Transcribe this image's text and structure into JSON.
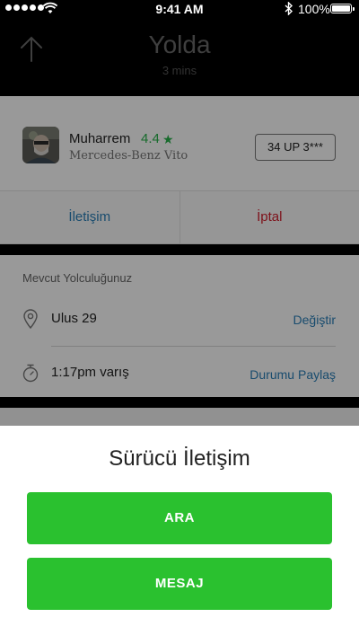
{
  "status_bar": {
    "time": "9:41 AM",
    "battery": "100%",
    "icons": [
      "signal-dots-icon",
      "wifi-icon",
      "bluetooth-icon",
      "battery-icon"
    ]
  },
  "header": {
    "title": "Yolda",
    "subtitle": "3 mins",
    "back_icon": "arrow-up-icon"
  },
  "driver": {
    "name": "Muharrem",
    "rating": "4.4",
    "rating_icon": "star-icon",
    "car": "Mercedes-Benz Vito",
    "plate": "34 UP 3***"
  },
  "actions": {
    "contact_label": "İletişim",
    "cancel_label": "İptal"
  },
  "trip": {
    "title": "Mevcut Yolculuğunuz",
    "destination": "Ulus 29",
    "change_label": "Değiştir",
    "eta": "1:17pm varış",
    "share_label": "Durumu Paylaş",
    "destination_icon": "map-pin-icon",
    "eta_icon": "stopwatch-icon"
  },
  "sheet": {
    "title": "Sürücü İletişim",
    "call_label": "ARA",
    "message_label": "MESAJ"
  },
  "colors": {
    "accent_green": "#2ac12f",
    "link_blue": "#2a7fb8",
    "cancel_red": "#d2202f",
    "rating_green": "#27b24a"
  }
}
